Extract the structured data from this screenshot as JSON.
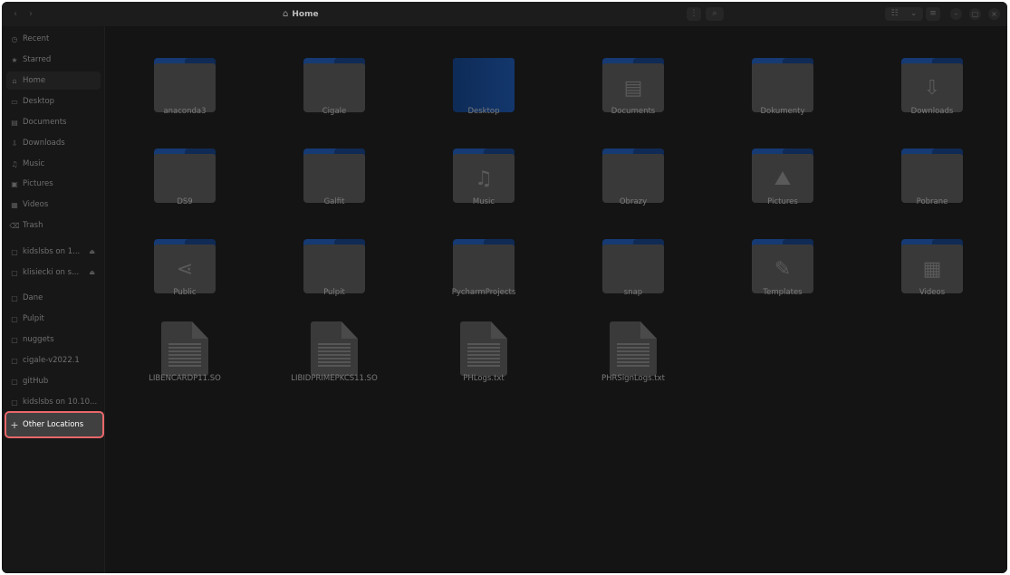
{
  "header": {
    "nav_back": "‹",
    "nav_forward": "›",
    "path_icon": "home-icon",
    "path_label": "Home",
    "menu_label": "⋮",
    "search_label": "⌕",
    "view_sort_label": "☷",
    "view_dropdown_label": "⌄",
    "view_list_label": "≡",
    "minimize_label": "–",
    "maximize_label": "▢",
    "close_label": "×"
  },
  "sidebar": {
    "items": [
      {
        "label": "Recent",
        "icon": "clock-icon",
        "glyph": "◷"
      },
      {
        "label": "Starred",
        "icon": "star-icon",
        "glyph": "★"
      },
      {
        "label": "Home",
        "icon": "home-icon",
        "glyph": "⌂"
      },
      {
        "label": "Desktop",
        "icon": "desktop-icon",
        "glyph": "▭"
      },
      {
        "label": "Documents",
        "icon": "document-icon",
        "glyph": "▤"
      },
      {
        "label": "Downloads",
        "icon": "download-icon",
        "glyph": "⇩"
      },
      {
        "label": "Music",
        "icon": "music-icon",
        "glyph": "♫"
      },
      {
        "label": "Pictures",
        "icon": "picture-icon",
        "glyph": "▣"
      },
      {
        "label": "Videos",
        "icon": "video-icon",
        "glyph": "▦"
      },
      {
        "label": "Trash",
        "icon": "trash-icon",
        "glyph": "⌫"
      },
      {
        "label": "kidslsbs on 1...",
        "icon": "network-folder-icon",
        "glyph": "▢",
        "eject": "⏏"
      },
      {
        "label": "klisiecki on s...",
        "icon": "network-folder-icon",
        "glyph": "▢",
        "eject": "⏏"
      },
      {
        "label": "Dane",
        "icon": "folder-icon",
        "glyph": "▢"
      },
      {
        "label": "Pulpit",
        "icon": "folder-icon",
        "glyph": "▢"
      },
      {
        "label": "nuggets",
        "icon": "folder-icon",
        "glyph": "▢"
      },
      {
        "label": "cigale-v2022.1",
        "icon": "folder-icon",
        "glyph": "▢"
      },
      {
        "label": "gitHub",
        "icon": "folder-icon",
        "glyph": "▢"
      },
      {
        "label": "kidslsbs on 10.10...",
        "icon": "folder-icon",
        "glyph": "▢"
      }
    ],
    "other_locations": {
      "label": "Other Locations",
      "icon": "plus-icon",
      "glyph": "+"
    }
  },
  "files": [
    {
      "name": "anaconda3",
      "kind": "folder",
      "glyph": ""
    },
    {
      "name": "Cigale",
      "kind": "folder",
      "glyph": ""
    },
    {
      "name": "Desktop",
      "kind": "desktop",
      "glyph": ""
    },
    {
      "name": "Documents",
      "kind": "folder",
      "glyph": "▤"
    },
    {
      "name": "Dokumenty",
      "kind": "folder",
      "glyph": ""
    },
    {
      "name": "Downloads",
      "kind": "folder",
      "glyph": "⇩"
    },
    {
      "name": "DS9",
      "kind": "folder",
      "glyph": ""
    },
    {
      "name": "Galfit",
      "kind": "folder",
      "glyph": ""
    },
    {
      "name": "Music",
      "kind": "folder",
      "glyph": "♫"
    },
    {
      "name": "Obrazy",
      "kind": "folder",
      "glyph": ""
    },
    {
      "name": "Pictures",
      "kind": "folder",
      "glyph": "⛰"
    },
    {
      "name": "Pobrane",
      "kind": "folder",
      "glyph": ""
    },
    {
      "name": "Public",
      "kind": "folder",
      "glyph": "⋖"
    },
    {
      "name": "Pulpit",
      "kind": "folder",
      "glyph": ""
    },
    {
      "name": "PycharmProjects",
      "kind": "folder",
      "glyph": ""
    },
    {
      "name": "snap",
      "kind": "folder",
      "glyph": ""
    },
    {
      "name": "Templates",
      "kind": "folder",
      "glyph": "✎"
    },
    {
      "name": "Videos",
      "kind": "folder",
      "glyph": "▦"
    },
    {
      "name": "LIBENCARDP11.SO",
      "kind": "file",
      "glyph": ""
    },
    {
      "name": "LIBIDPRIMEPKCS11.SO",
      "kind": "file",
      "glyph": ""
    },
    {
      "name": "PHLogs.txt",
      "kind": "file",
      "glyph": ""
    },
    {
      "name": "PHRSignLogs.txt",
      "kind": "file",
      "glyph": ""
    }
  ]
}
